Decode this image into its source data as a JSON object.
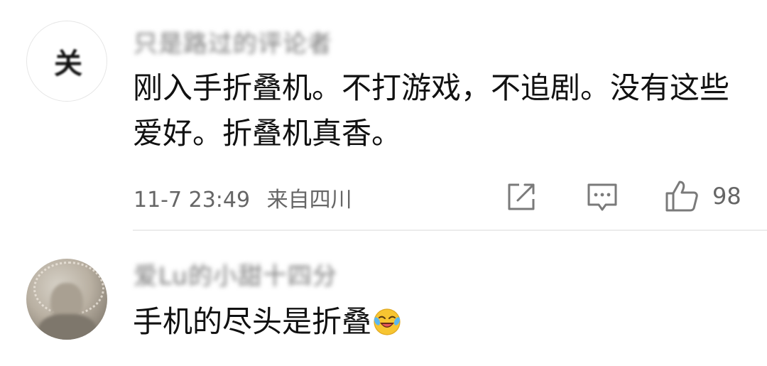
{
  "comments": [
    {
      "username": "只是路过的评论者",
      "text": "刚入手折叠机。不打游戏，不追剧。没有这些爱好。折叠机真香。",
      "timestamp": "11-7 23:49",
      "location": "来自四川",
      "like_count": "98",
      "icons": {
        "share": "share-icon",
        "reply": "comment-icon",
        "like": "thumbs-up-icon"
      }
    },
    {
      "username": "爱Lu的小甜十四分",
      "text": "手机的尽头是折叠",
      "emoji": "laughing-crying-emoji"
    }
  ],
  "colors": {
    "text": "#111111",
    "meta": "#666666",
    "divider": "#ececec",
    "icon": "#7a7a7a"
  }
}
